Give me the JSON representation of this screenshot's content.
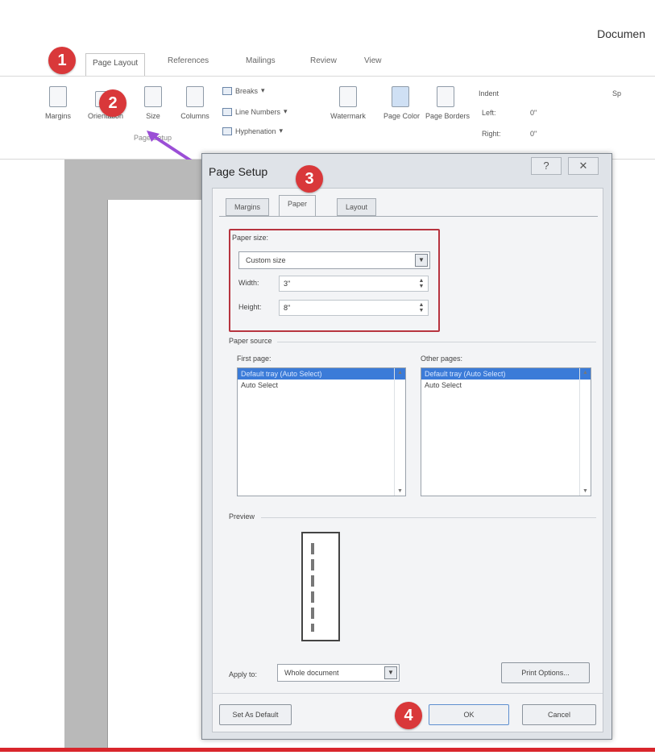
{
  "window": {
    "title": "Documen"
  },
  "tabs": [
    {
      "label": "Page Layout",
      "active": true
    },
    {
      "label": "References"
    },
    {
      "label": "Mailings"
    },
    {
      "label": "Review"
    },
    {
      "label": "View"
    }
  ],
  "ribbon": {
    "buttons": [
      "Margins",
      "Orientation",
      "Size",
      "Columns"
    ],
    "small": [
      "Breaks",
      "Line Numbers",
      "Hyphenation"
    ],
    "background": [
      "Watermark",
      "Page Color",
      "Page Borders"
    ],
    "group_label": "Page Setup",
    "indent": {
      "title": "Indent",
      "left_label": "Left:",
      "left_value": "0\"",
      "right_label": "Right:",
      "right_value": "0\""
    },
    "spacing_title": "Sp"
  },
  "dialog": {
    "title": "Page Setup",
    "help_glyph": "?",
    "close_glyph": "✕",
    "tabs": [
      "Margins",
      "Paper",
      "Layout"
    ],
    "active_tab": "Paper",
    "paper_size_label": "Paper size:",
    "paper_size_value": "Custom size",
    "width_label": "Width:",
    "width_value": "3\"",
    "height_label": "Height:",
    "height_value": "8\"",
    "paper_source_label": "Paper source",
    "first_page_label": "First page:",
    "first_page_items": [
      "Default tray (Auto Select)",
      "Auto Select"
    ],
    "other_pages_label": "Other pages:",
    "other_pages_items": [
      "Default tray (Auto Select)",
      "Auto Select"
    ],
    "preview_label": "Preview",
    "apply_to_label": "Apply to:",
    "apply_to_value": "Whole document",
    "print_options_label": "Print Options...",
    "set_default_label": "Set As Default",
    "ok_label": "OK",
    "cancel_label": "Cancel"
  },
  "badges": [
    "1",
    "2",
    "3",
    "4"
  ],
  "colors": {
    "badge": "#d9383a",
    "highlight_box": "#b7343f",
    "selection": "#3b7bd8",
    "arrow": "#9b4fd6",
    "bottom_rule": "#d9262c"
  }
}
